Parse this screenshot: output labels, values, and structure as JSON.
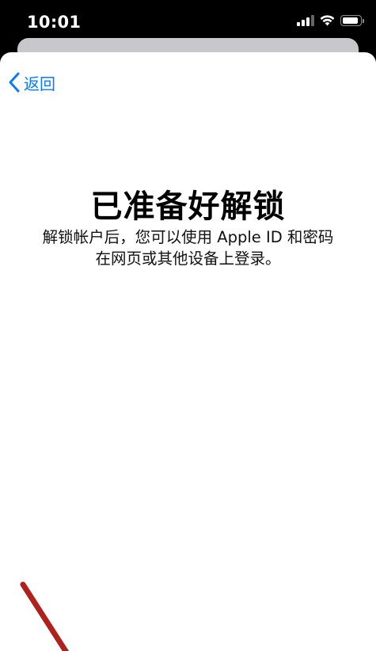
{
  "status_bar": {
    "time": "10:01",
    "signal_icon": "cellular-signal-icon",
    "wifi_icon": "wifi-icon",
    "battery_icon": "battery-icon",
    "battery_level": 0.9
  },
  "nav": {
    "back_label": "返回",
    "back_icon": "chevron-left-icon"
  },
  "content": {
    "title": "已准备好解锁",
    "description_line1": "解锁帐户后，您可以使用 Apple ID 和密码",
    "description_line2": "在网页或其他设备上登录。"
  },
  "colors": {
    "accent": "#0a7aff",
    "background": "#000000",
    "sheet": "#ffffff",
    "annotation": "#b0201c"
  }
}
